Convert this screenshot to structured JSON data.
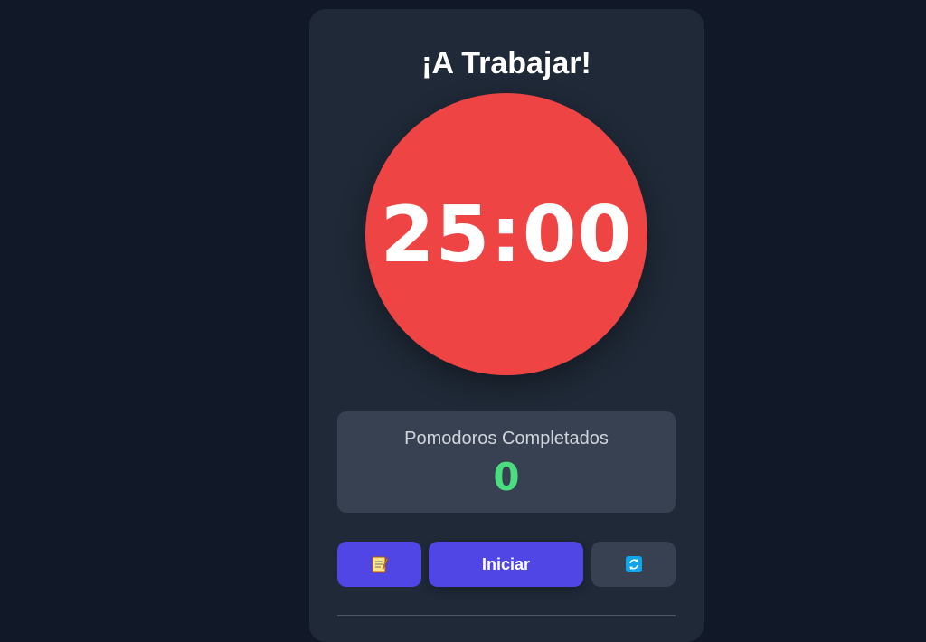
{
  "app": {
    "title": "¡A Trabajar!"
  },
  "timer": {
    "display": "25:00",
    "color": "#ef4444"
  },
  "stats": {
    "label": "Pomodoros Completados",
    "value": "0",
    "value_color": "#4ade80"
  },
  "controls": {
    "notes_icon": "memo-icon",
    "start_label": "Iniciar",
    "reset_icon": "refresh-icon",
    "accent": "#4f46e5"
  }
}
